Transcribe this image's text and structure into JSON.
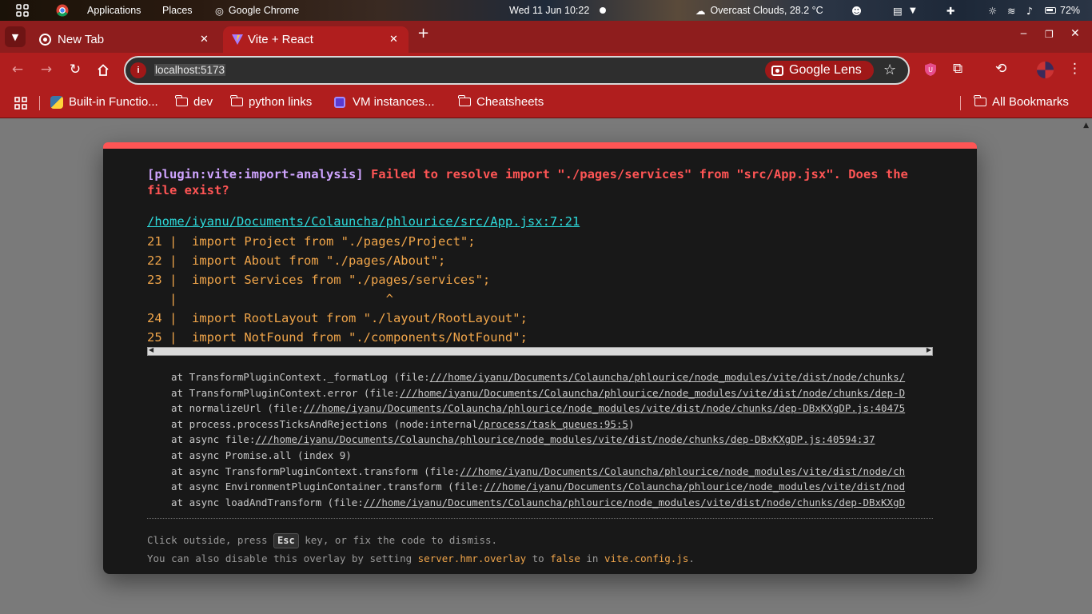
{
  "topbar": {
    "activities_icon": "grid-icon",
    "app1": "Applications",
    "app2": "Places",
    "app3": "Google Chrome",
    "datetime": "Wed 11 Jun  10:22",
    "weather": "Overcast Clouds, 28.2 °C",
    "battery": "72%"
  },
  "tabs": [
    {
      "title": "New Tab",
      "icon": "chrome-icon"
    },
    {
      "title": "Vite + React",
      "icon": "vite-icon"
    }
  ],
  "toolbar": {
    "url": "localhost:5173",
    "lens": "Google Lens"
  },
  "bookmarks": [
    {
      "label": "Built-in Functio...",
      "icon": "python-icon"
    },
    {
      "label": "dev",
      "icon": "folder-icon"
    },
    {
      "label": "python links",
      "icon": "folder-icon"
    },
    {
      "label": "VM instances...",
      "icon": "chip-icon"
    },
    {
      "label": "Cheatsheets",
      "icon": "folder-icon"
    },
    {
      "label": "All Bookmarks",
      "icon": "folder-icon"
    }
  ],
  "error": {
    "plugin": "[plugin:vite:import-analysis]",
    "message": "Failed to resolve import \"./pages/services\" from \"src/App.jsx\". Does the file exist?",
    "file": "/home/iyanu/Documents/Colauncha/phlourice/src/App.jsx:7:21",
    "frame": [
      "21 |  import Project from \"./pages/Project\";",
      "22 |  import About from \"./pages/About\";",
      "23 |  import Services from \"./pages/services\";",
      "   |                            ^",
      "24 |  import RootLayout from \"./layout/RootLayout\";",
      "25 |  import NotFound from \"./components/NotFound\";"
    ],
    "stack": [
      {
        "pre": "at TransformPluginContext._formatLog (file:",
        "link": "///home/iyanu/Documents/Colauncha/phlourice/node_modules/vite/dist/node/chunks/",
        "post": ""
      },
      {
        "pre": "at TransformPluginContext.error (file:",
        "link": "///home/iyanu/Documents/Colauncha/phlourice/node_modules/vite/dist/node/chunks/dep-D",
        "post": ""
      },
      {
        "pre": "at normalizeUrl (file:",
        "link": "///home/iyanu/Documents/Colauncha/phlourice/node_modules/vite/dist/node/chunks/dep-DBxKXgDP.js:40475",
        "post": ""
      },
      {
        "pre": "at process.processTicksAndRejections (node:internal",
        "link": "/process/task_queues:95:5",
        "post": ")"
      },
      {
        "pre": "at async file:",
        "link": "///home/iyanu/Documents/Colauncha/phlourice/node_modules/vite/dist/node/chunks/dep-DBxKXgDP.js:40594:37",
        "post": ""
      },
      {
        "pre": "at async Promise.all (index 9)",
        "link": "",
        "post": ""
      },
      {
        "pre": "at async TransformPluginContext.transform (file:",
        "link": "///home/iyanu/Documents/Colauncha/phlourice/node_modules/vite/dist/node/ch",
        "post": ""
      },
      {
        "pre": "at async EnvironmentPluginContainer.transform (file:",
        "link": "///home/iyanu/Documents/Colauncha/phlourice/node_modules/vite/dist/nod",
        "post": ""
      },
      {
        "pre": "at async loadAndTransform (file:",
        "link": "///home/iyanu/Documents/Colauncha/phlourice/node_modules/vite/dist/node/chunks/dep-DBxKXgD",
        "post": ""
      }
    ],
    "tip1_pre": "Click outside, press ",
    "tip1_key": "Esc",
    "tip1_post": " key, or fix the code to dismiss.",
    "tip2_pre": "You can also disable this overlay by setting ",
    "tip2_code1": "server.hmr.overlay",
    "tip2_mid": " to ",
    "tip2_code2": "false",
    "tip2_mid2": " in ",
    "tip2_code3": "vite.config.js",
    "tip2_end": "."
  },
  "colors": {
    "chrome_frame": "#8e1d1d",
    "chrome_toolbar": "#b01e1e",
    "error_red": "#ff5555",
    "plugin_purple": "#cfa4ff",
    "link_cyan": "#2dd9da",
    "code_orange": "#f0a54a"
  }
}
